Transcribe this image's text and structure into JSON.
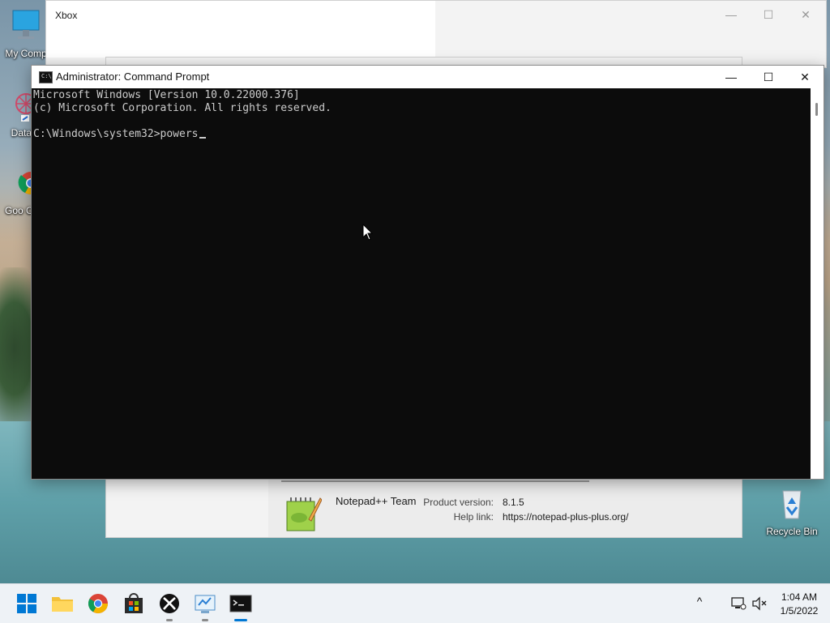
{
  "desktop": {
    "icons": [
      {
        "label": "My Comp"
      },
      {
        "label": "DataW"
      },
      {
        "label": "Goo Chro"
      },
      {
        "label": "Recycle Bin"
      }
    ]
  },
  "xbox_window": {
    "title": "Xbox",
    "minimize": "—",
    "maximize": "☐",
    "close": "✕"
  },
  "notepad_about": {
    "team": "Notepad++ Team",
    "product_version_label": "Product version:",
    "product_version": "8.1.5",
    "help_link_label": "Help link:",
    "help_link": "https://notepad-plus-plus.org/"
  },
  "cmd_window": {
    "title": "Administrator: Command Prompt",
    "icon_text": "C:\\",
    "minimize": "—",
    "maximize": "☐",
    "close": "✕",
    "lines": [
      "Microsoft Windows [Version 10.0.22000.376]",
      "(c) Microsoft Corporation. All rights reserved.",
      "",
      "C:\\Windows\\system32>powers"
    ]
  },
  "taskbar": {
    "apps": [
      {
        "name": "Start"
      },
      {
        "name": "File Explorer"
      },
      {
        "name": "Google Chrome"
      },
      {
        "name": "Microsoft Store"
      },
      {
        "name": "Xbox"
      },
      {
        "name": "Control Panel"
      },
      {
        "name": "Command Prompt"
      }
    ],
    "tray": {
      "chevron": "^",
      "time": "1:04 AM",
      "date": "1/5/2022"
    }
  },
  "colors": {
    "console_bg": "#0c0c0c",
    "console_fg": "#cccccc",
    "taskbar_bg": "#eef2f6",
    "accent": "#0078d4"
  }
}
